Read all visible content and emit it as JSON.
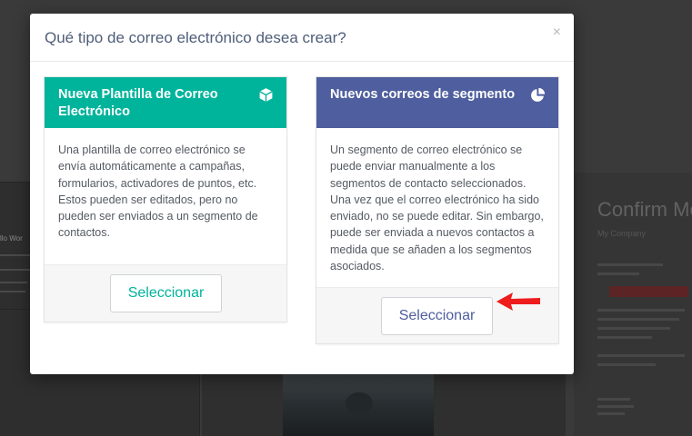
{
  "modal": {
    "title": "Qué tipo de correo electrónico desea crear?",
    "close_label": "×"
  },
  "cards": [
    {
      "title": "Nueva Plantilla de Correo Electrónico",
      "icon": "cube-icon",
      "color": "#00b49c",
      "description": "Una plantilla de correo electrónico se envía automáticamente a campañas, formularios, activadores de puntos, etc. Estos pueden ser editados, pero no pueden ser enviados a un segmento de contactos.",
      "button_label": "Seleccionar"
    },
    {
      "title": "Nuevos correos de segmento",
      "icon": "pie-chart-icon",
      "color": "#4e5e9e",
      "description": "Un segmento de correo electrónico se puede enviar manualmente a los segmentos de contacto seleccionados. Una vez que el correo electrónico ha sido enviado, no se puede editar. Sin embargo, puede ser enviada a nuevos contactos a medida que se añaden a los segmentos asociados.",
      "button_label": "Seleccionar"
    }
  ],
  "annotation": {
    "icon": "red-arrow-icon",
    "color": "#ee1c1c"
  },
  "background": {
    "left_text": "llo Wor",
    "confirm_title": "Confirm Me",
    "company": "My Company"
  }
}
